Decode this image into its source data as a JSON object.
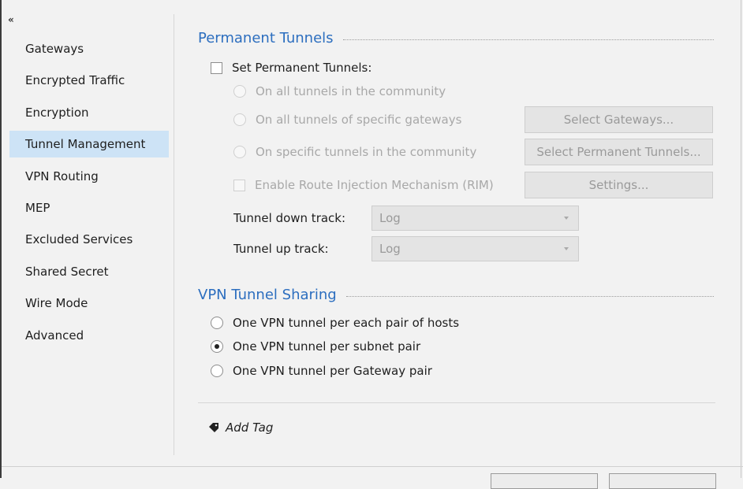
{
  "collapse_glyph": "«",
  "sidebar": {
    "items": [
      {
        "label": "Gateways"
      },
      {
        "label": "Encrypted Traffic"
      },
      {
        "label": "Encryption"
      },
      {
        "label": "Tunnel Management",
        "active": true
      },
      {
        "label": "VPN Routing"
      },
      {
        "label": "MEP"
      },
      {
        "label": "Excluded Services"
      },
      {
        "label": "Shared Secret"
      },
      {
        "label": "Wire Mode"
      },
      {
        "label": "Advanced"
      }
    ]
  },
  "permanent_tunnels": {
    "title": "Permanent Tunnels",
    "set_permanent_label": "Set Permanent Tunnels:",
    "set_permanent_checked": false,
    "options": [
      {
        "label": "On all tunnels in the community"
      },
      {
        "label": "On all tunnels of specific gateways"
      },
      {
        "label": "On specific tunnels in the community"
      }
    ],
    "select_gateways_label": "Select Gateways...",
    "select_permanent_tunnels_label": "Select Permanent Tunnels...",
    "rim_label": "Enable Route Injection Mechanism (RIM)",
    "rim_checked": false,
    "settings_label": "Settings...",
    "tunnel_down_label": "Tunnel down track:",
    "tunnel_down_value": "Log",
    "tunnel_up_label": "Tunnel up track:",
    "tunnel_up_value": "Log"
  },
  "vpn_tunnel_sharing": {
    "title": "VPN Tunnel Sharing",
    "options": [
      {
        "label": "One VPN tunnel per each pair of hosts",
        "checked": false
      },
      {
        "label": "One VPN tunnel per subnet pair",
        "checked": true
      },
      {
        "label": "One VPN tunnel per Gateway pair",
        "checked": false
      }
    ]
  },
  "add_tag_label": "Add Tag",
  "icons": {
    "collapse": "double-chevron-left-icon",
    "tag": "tag-icon",
    "dropdown": "caret-down-icon"
  },
  "colors": {
    "accent": "#2c6ebf",
    "active_nav": "#cde3f6",
    "disabled_text": "#a8a8a8"
  }
}
